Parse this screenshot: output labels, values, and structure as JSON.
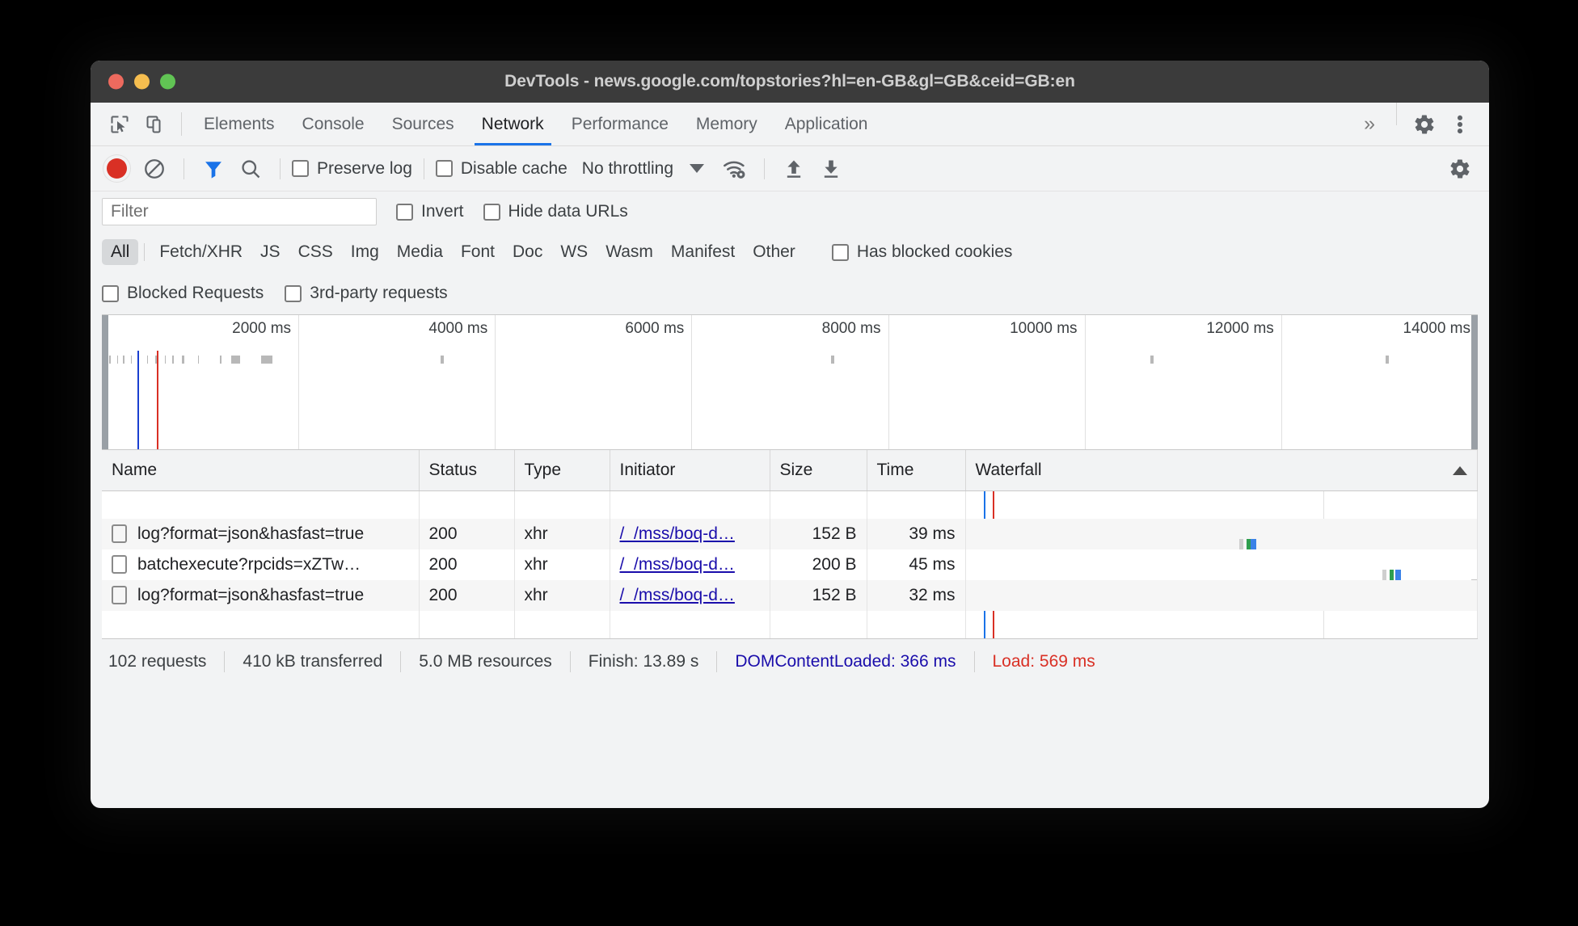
{
  "window": {
    "title": "DevTools - news.google.com/topstories?hl=en-GB&gl=GB&ceid=GB:en"
  },
  "tabbar": {
    "inspect_icon": "inspect-cursor-icon",
    "device_icon": "device-toolbar-icon",
    "tabs": [
      {
        "label": "Elements",
        "active": false
      },
      {
        "label": "Console",
        "active": false
      },
      {
        "label": "Sources",
        "active": false
      },
      {
        "label": "Network",
        "active": true
      },
      {
        "label": "Performance",
        "active": false
      },
      {
        "label": "Memory",
        "active": false
      },
      {
        "label": "Application",
        "active": false
      }
    ],
    "overflow_label": "»",
    "settings_icon": "gear-icon",
    "more_icon": "vertical-dots-icon",
    "active_tab_color": "#1a73e8"
  },
  "toolbar": {
    "record_icon": "record-button",
    "record_color": "#d93025",
    "clear_icon": "clear-icon",
    "filter_icon": "filter-funnel-icon",
    "filter_icon_color": "#1a73e8",
    "search_icon": "search-icon",
    "preserve_log_label": "Preserve log",
    "preserve_log_checked": false,
    "disable_cache_label": "Disable cache",
    "disable_cache_checked": false,
    "throttling_value": "No throttling",
    "network_conditions_icon": "wifi-settings-icon",
    "export_har_icon": "upload-arrow-icon",
    "import_har_icon": "download-arrow-icon",
    "settings_icon": "gear-icon"
  },
  "filters": {
    "filter_placeholder": "Filter",
    "filter_value": "",
    "invert_label": "Invert",
    "invert_checked": false,
    "hide_data_urls_label": "Hide data URLs",
    "hide_data_urls_checked": false,
    "types": [
      {
        "label": "All",
        "active": true
      },
      {
        "label": "Fetch/XHR",
        "active": false
      },
      {
        "label": "JS",
        "active": false
      },
      {
        "label": "CSS",
        "active": false
      },
      {
        "label": "Img",
        "active": false
      },
      {
        "label": "Media",
        "active": false
      },
      {
        "label": "Font",
        "active": false
      },
      {
        "label": "Doc",
        "active": false
      },
      {
        "label": "WS",
        "active": false
      },
      {
        "label": "Wasm",
        "active": false
      },
      {
        "label": "Manifest",
        "active": false
      },
      {
        "label": "Other",
        "active": false
      }
    ],
    "has_blocked_cookies_label": "Has blocked cookies",
    "has_blocked_cookies_checked": false,
    "blocked_requests_label": "Blocked Requests",
    "blocked_requests_checked": false,
    "third_party_label": "3rd-party requests",
    "third_party_checked": false
  },
  "overview": {
    "ticks": [
      "2000 ms",
      "4000 ms",
      "6000 ms",
      "8000 ms",
      "10000 ms",
      "12000 ms",
      "14000 ms"
    ],
    "dcl_color": "#1a3fd0",
    "load_color": "#d93025"
  },
  "table": {
    "columns": [
      {
        "label": "Name",
        "align": "left"
      },
      {
        "label": "Status",
        "align": "left"
      },
      {
        "label": "Type",
        "align": "left"
      },
      {
        "label": "Initiator",
        "align": "left"
      },
      {
        "label": "Size",
        "align": "right"
      },
      {
        "label": "Time",
        "align": "right"
      },
      {
        "label": "Waterfall",
        "align": "left"
      }
    ],
    "sort_indicator": "ascending-arrow-icon",
    "rows": [
      {
        "name": "log?format=json&hasfast=true",
        "status": "200",
        "type": "xhr",
        "initiator": "/_/mss/boq-d…",
        "size": "152 B",
        "time": "39 ms"
      },
      {
        "name": "batchexecute?rpcids=xZTw…",
        "status": "200",
        "type": "xhr",
        "initiator": "/_/mss/boq-d…",
        "size": "200 B",
        "time": "45 ms"
      },
      {
        "name": "log?format=json&hasfast=true",
        "status": "200",
        "type": "xhr",
        "initiator": "/_/mss/boq-d…",
        "size": "152 B",
        "time": "32 ms"
      }
    ]
  },
  "statusbar": {
    "requests": "102 requests",
    "transferred": "410 kB transferred",
    "resources": "5.0 MB resources",
    "finish": "Finish: 13.89 s",
    "dom_content_loaded": "DOMContentLoaded: 366 ms",
    "load": "Load: 569 ms",
    "dcl_color": "#1a0dab",
    "load_color": "#d93025"
  }
}
